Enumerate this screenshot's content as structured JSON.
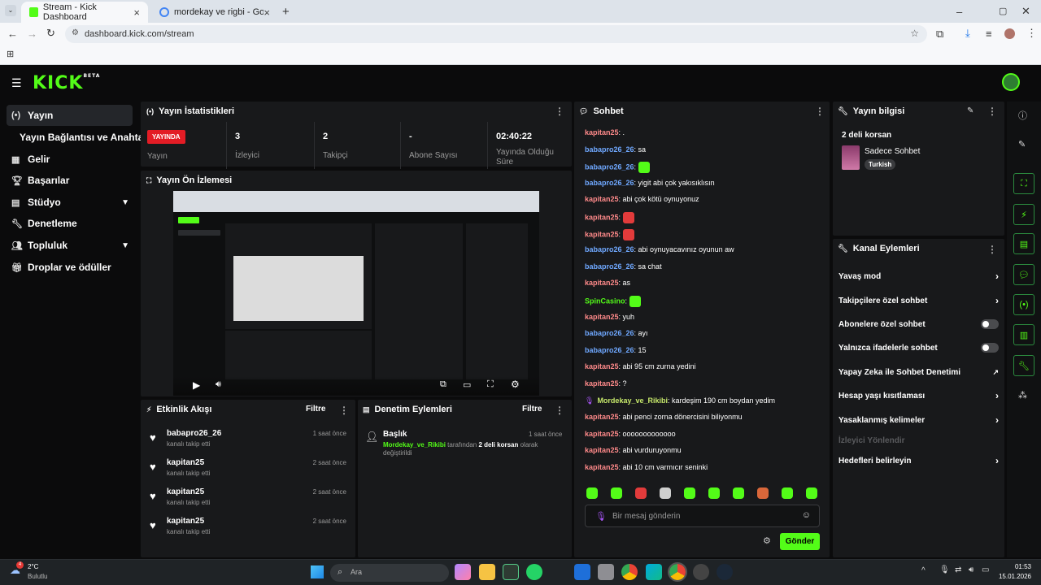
{
  "browser": {
    "tabs": [
      {
        "title": "Stream - Kick Dashboard"
      },
      {
        "title": "mordekay ve rigbi - Google'da"
      }
    ],
    "url": "dashboard.kick.com/stream"
  },
  "kick": {
    "logo": "KICK",
    "logo_beta": "BETA"
  },
  "sidebar": {
    "items": [
      {
        "label": "Yayın",
        "icon": "broadcast-icon"
      },
      {
        "label": "Yayın Bağlantısı ve Anahtarı",
        "icon": ""
      },
      {
        "label": "Gelir",
        "icon": "chart-icon"
      },
      {
        "label": "Başarılar",
        "icon": "trophy-icon"
      },
      {
        "label": "Stüdyo",
        "icon": "studio-icon"
      },
      {
        "label": "Denetleme",
        "icon": "wrench-icon"
      },
      {
        "label": "Topluluk",
        "icon": "people-icon"
      },
      {
        "label": "Droplar ve ödüller",
        "icon": "gift-icon"
      }
    ]
  },
  "stats": {
    "title": "Yayın İstatistikleri",
    "live_badge": "YAYINDA",
    "live_label": "Yayın",
    "items": [
      {
        "value": "3",
        "label": "İzleyici"
      },
      {
        "value": "2",
        "label": "Takipçi"
      },
      {
        "value": "-",
        "label": "Abone Sayısı"
      },
      {
        "value": "02:40:22",
        "label": "Yayında Olduğu Süre"
      }
    ]
  },
  "preview": {
    "title": "Yayın Ön İzlemesi"
  },
  "activity": {
    "title": "Etkinlik Akışı",
    "filter": "Filtre",
    "events": [
      {
        "name": "babapro26_26",
        "action": "kanalı takip etti",
        "time": "1 saat önce"
      },
      {
        "name": "kapitan25",
        "action": "kanalı takip etti",
        "time": "2 saat önce"
      },
      {
        "name": "kapitan25",
        "action": "kanalı takip etti",
        "time": "2 saat önce"
      },
      {
        "name": "kapitan25",
        "action": "kanalı takip etti",
        "time": "2 saat önce"
      }
    ]
  },
  "moderation": {
    "title": "Denetim Eylemleri",
    "filter": "Filtre",
    "entry_title": "Başlık",
    "entry_time": "1 saat önce",
    "entry_user": "Mordekay_ve_Rikibi",
    "entry_mid": "tarafından",
    "entry_value": "2 deli korsan",
    "entry_rest": "olarak",
    "entry_line2": "değiştirildi"
  },
  "chat": {
    "title": "Sohbet",
    "messages": [
      {
        "user": "kapitan25",
        "text": ".",
        "color": "#ff8a8a"
      },
      {
        "user": "babapro26_26",
        "text": "sa",
        "color": "#6fa8ff"
      },
      {
        "user": "babapro26_26",
        "text": "",
        "color": "#6fa8ff",
        "emote": "#53fc18"
      },
      {
        "user": "babapro26_26",
        "text": "yigit abi çok yakısıklısın",
        "color": "#6fa8ff"
      },
      {
        "user": "kapitan25",
        "text": "abi çok kötü oynuyonuz",
        "color": "#ff8a8a"
      },
      {
        "user": "kapitan25",
        "text": "",
        "color": "#ff8a8a",
        "emote": "#e23b3b"
      },
      {
        "user": "kapitan25",
        "text": "",
        "color": "#ff8a8a",
        "emote": "#e23b3b"
      },
      {
        "user": "babapro26_26",
        "text": "abi oynuyacavınız oyunun aw",
        "color": "#6fa8ff"
      },
      {
        "user": "babapro26_26",
        "text": "sa chat",
        "color": "#6fa8ff"
      },
      {
        "user": "kapitan25",
        "text": "as",
        "color": "#ff8a8a"
      },
      {
        "user": "SpinCasino",
        "text": "",
        "color": "#53fc18",
        "emote": "#53fc18"
      },
      {
        "user": "kapitan25",
        "text": "yuh",
        "color": "#ff8a8a"
      },
      {
        "user": "babapro26_26",
        "text": "ayı",
        "color": "#6fa8ff"
      },
      {
        "user": "babapro26_26",
        "text": "15",
        "color": "#6fa8ff"
      },
      {
        "user": "kapitan25",
        "text": "abi 95 cm zurna yedini",
        "color": "#ff8a8a"
      },
      {
        "user": "kapitan25",
        "text": "?",
        "color": "#ff8a8a"
      },
      {
        "user": "Mordekay_ve_Rikibi",
        "text": "kardeşim 190 cm boydan yedim",
        "color": "#c6e86b",
        "badge": true
      },
      {
        "user": "kapitan25",
        "text": "abi penci zorna dönercisini biliyonmu",
        "color": "#ff8a8a"
      },
      {
        "user": "kapitan25",
        "text": "ooooooooooooo",
        "color": "#ff8a8a"
      },
      {
        "user": "kapitan25",
        "text": "abi vurduruyonmu",
        "color": "#ff8a8a"
      },
      {
        "user": "kapitan25",
        "text": "abi 10 cm varmıcır seninki",
        "color": "#ff8a8a"
      }
    ],
    "emote_colors": [
      "#53fc18",
      "#53fc18",
      "#e23b3b",
      "#cfcfcf",
      "#53fc18",
      "#53fc18",
      "#53fc18",
      "#d9673a",
      "#53fc18",
      "#53fc18"
    ],
    "input_placeholder": "Bir mesaj gönderin",
    "send_label": "Gönder"
  },
  "stream_info": {
    "title": "Yayın bilgisi",
    "stream_title": "2 deli korsan",
    "category": "Sadece Sohbet",
    "language": "Turkish"
  },
  "channel_actions": {
    "title": "Kanal Eylemleri",
    "items": [
      {
        "label": "Yavaş mod",
        "type": "arrow"
      },
      {
        "label": "Takipçilere özel sohbet",
        "type": "arrow"
      },
      {
        "label": "Abonelere özel sohbet",
        "type": "toggle"
      },
      {
        "label": "Yalnızca ifadelerle sohbet",
        "type": "toggle"
      },
      {
        "label": "Yapay Zeka ile Sohbet Denetimi",
        "type": "external"
      },
      {
        "label": "Hesap yaşı kısıtlaması",
        "type": "arrow"
      },
      {
        "label": "Yasaklanmış kelimeler",
        "type": "arrow"
      },
      {
        "label": "İzleyici Yönlendir",
        "type": "disabled"
      },
      {
        "label": "Hedefleri belirleyin",
        "type": "arrow"
      }
    ]
  },
  "taskbar": {
    "weather_temp": "2°C",
    "weather_desc": "Bulutlu",
    "weather_badge": "4",
    "search_placeholder": "Ara",
    "time": "01:53",
    "date": "15.01.2026"
  }
}
